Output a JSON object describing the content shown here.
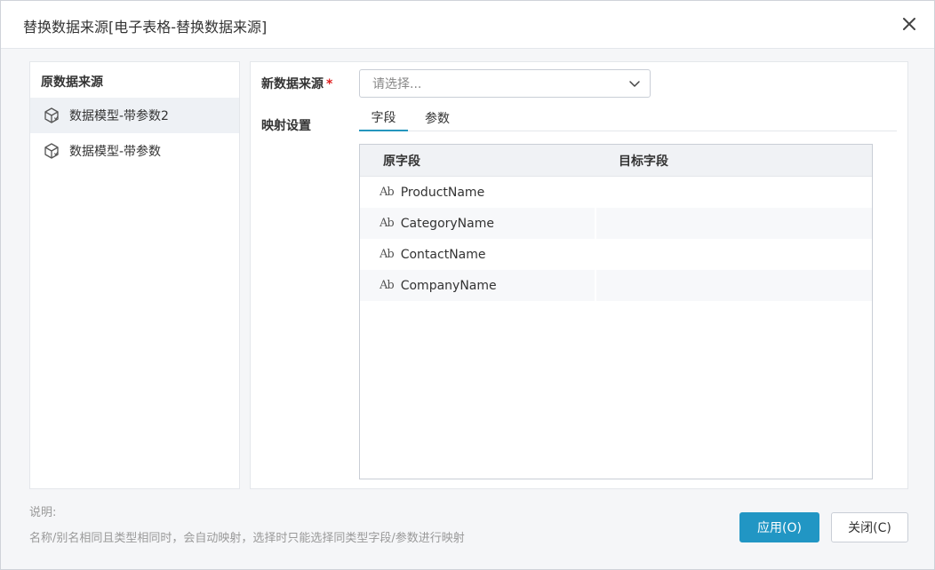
{
  "dialog": {
    "title": "替换数据来源[电子表格-替换数据来源]"
  },
  "left": {
    "header": "原数据来源",
    "items": [
      {
        "label": "数据模型-带参数2",
        "icon": "cube-icon"
      },
      {
        "label": "数据模型-带参数",
        "icon": "cube-icon"
      }
    ]
  },
  "right": {
    "new_source_label": "新数据来源",
    "required_mark": "*",
    "select_placeholder": "请选择...",
    "mapping_label": "映射设置",
    "tabs": [
      {
        "label": "字段"
      },
      {
        "label": "参数"
      }
    ],
    "grid": {
      "columns": [
        "原字段",
        "目标字段"
      ],
      "type_icon_text": "Ab",
      "rows": [
        {
          "source": "ProductName",
          "target": ""
        },
        {
          "source": "CategoryName",
          "target": ""
        },
        {
          "source": "ContactName",
          "target": ""
        },
        {
          "source": "CompanyName",
          "target": ""
        }
      ]
    }
  },
  "footer": {
    "desc_title": "说明:",
    "desc_text": "名称/别名相同且类型相同时，会自动映射，选择时只能选择同类型字段/参数进行映射",
    "apply_label": "应用(O)",
    "close_label": "关闭(C)"
  },
  "colors": {
    "accent": "#2196c4",
    "required": "#e02020"
  }
}
